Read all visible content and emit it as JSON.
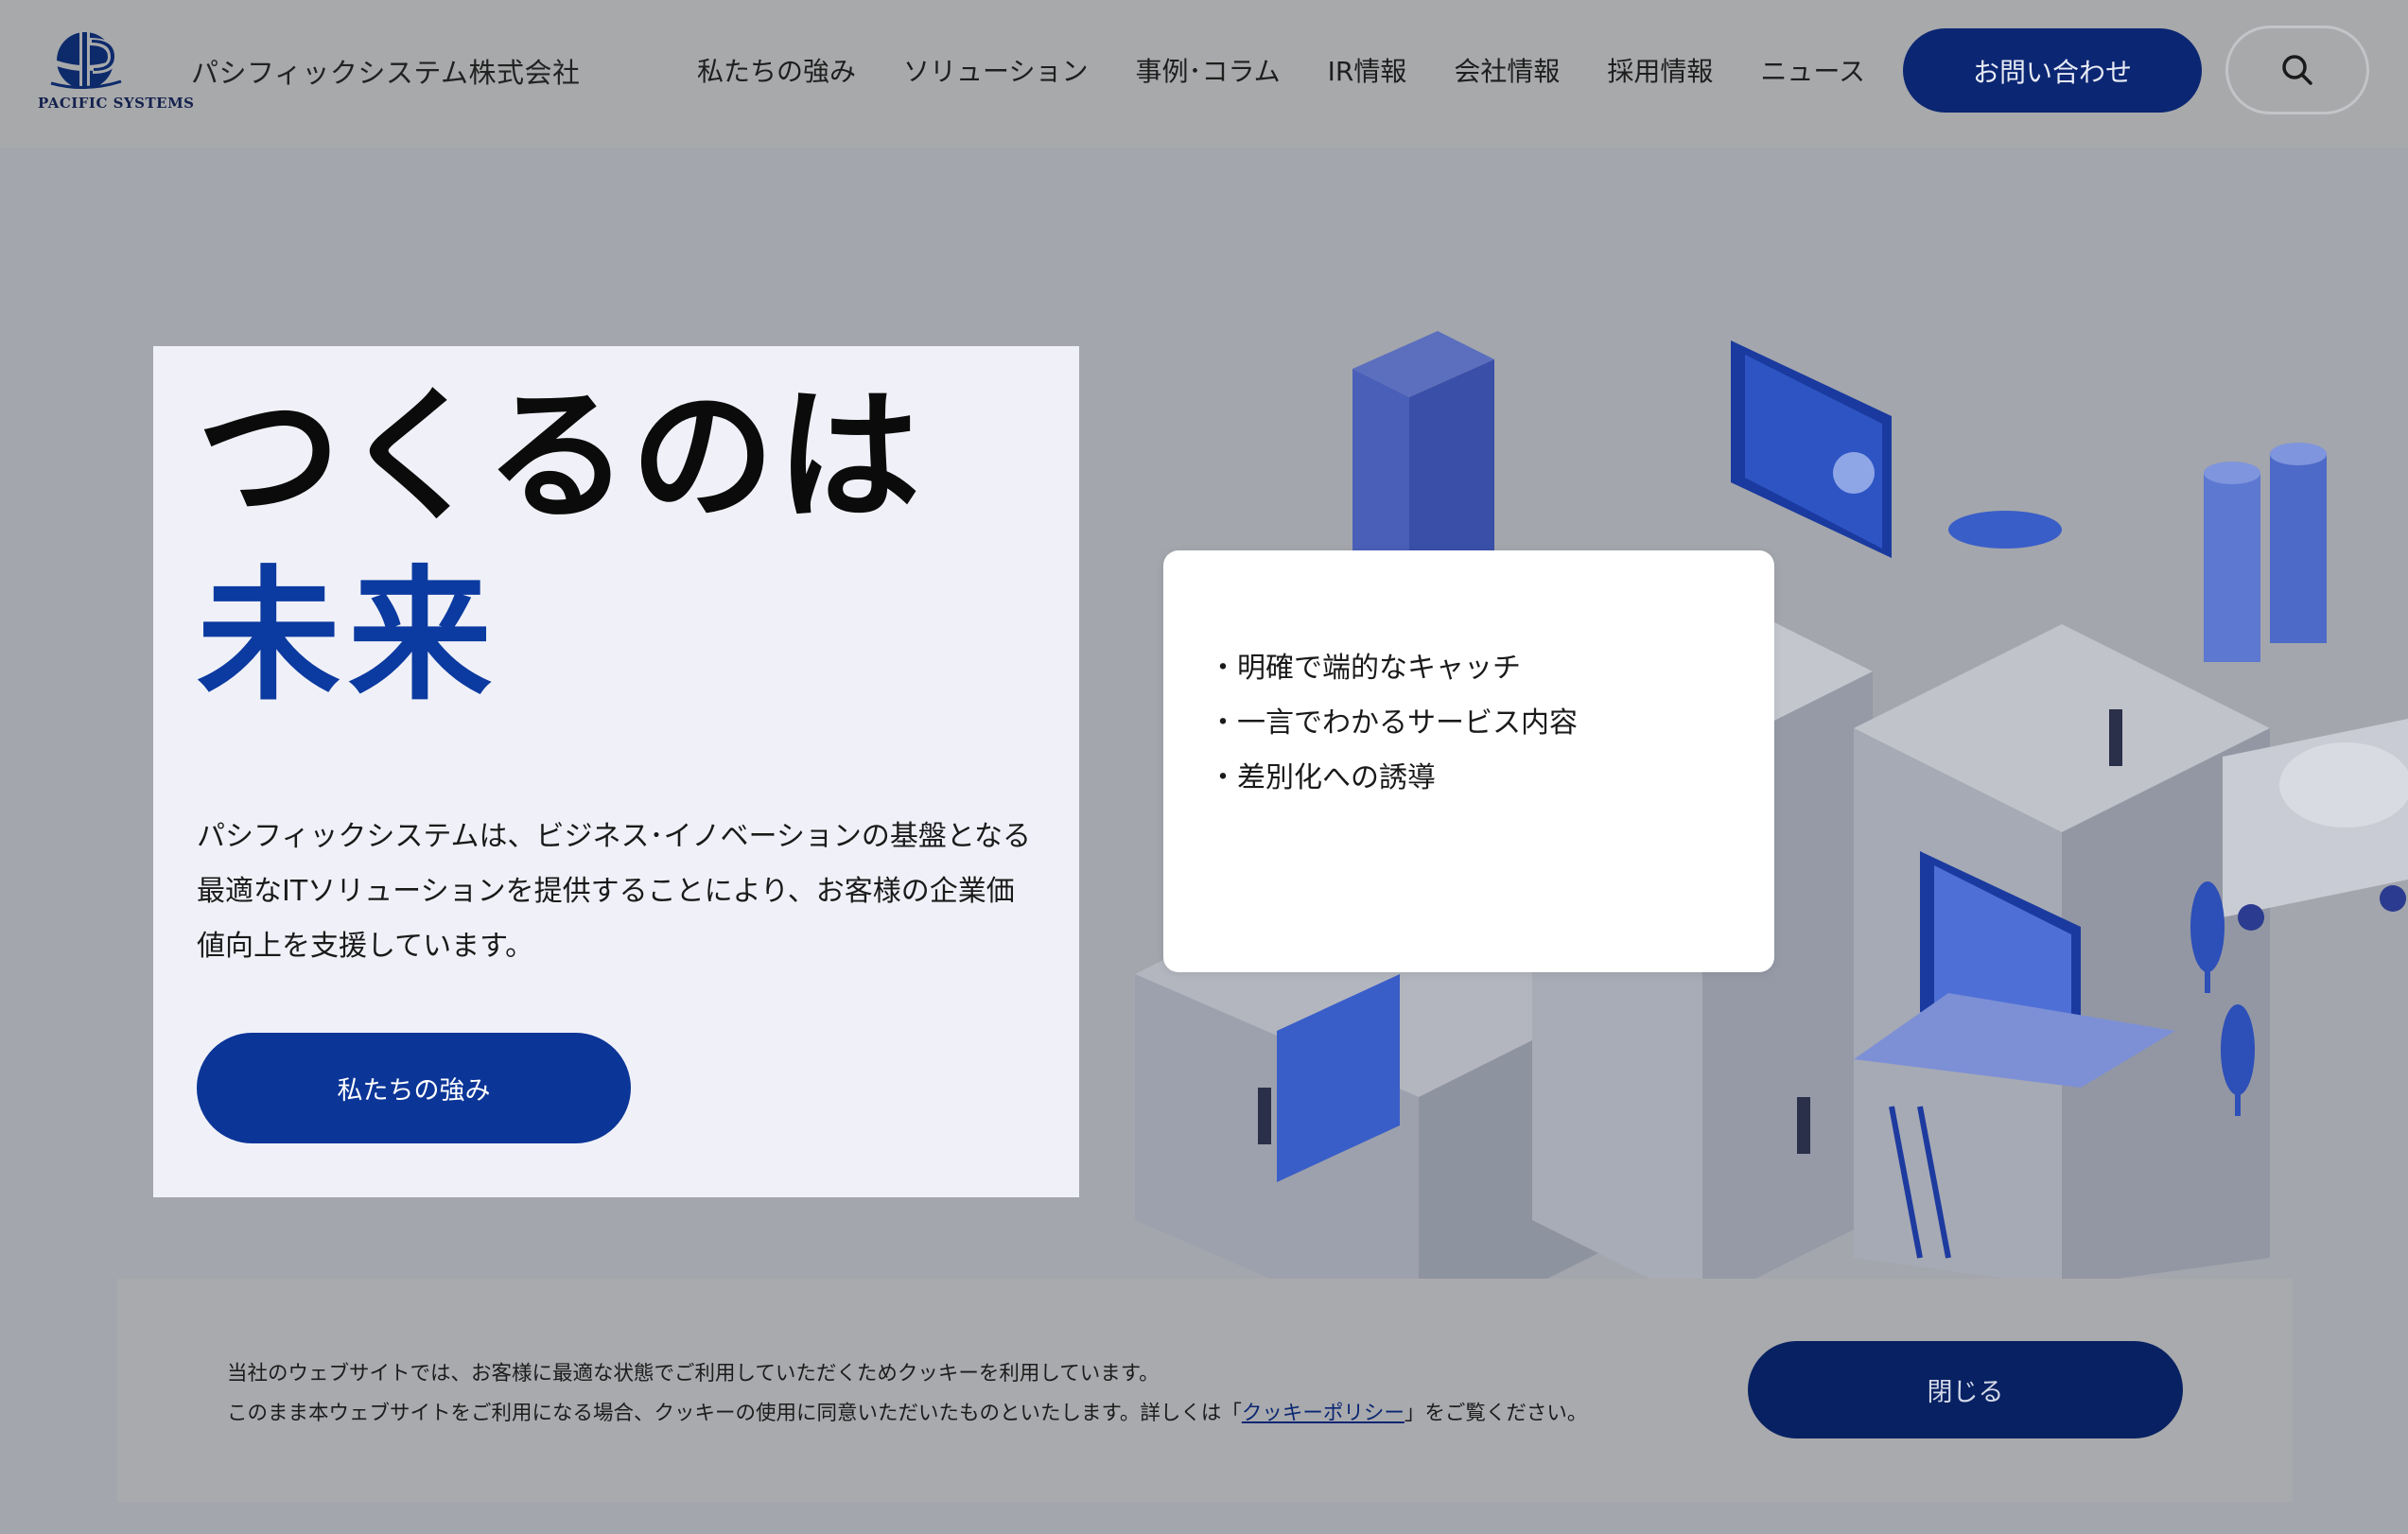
{
  "header": {
    "logo_en": "PACIFIC SYSTEMS",
    "logo_jp": "パシフィックシステム株式会社",
    "nav": [
      "私たちの強み",
      "ソリューション",
      "事例･コラム",
      "IR情報",
      "会社情報",
      "採用情報",
      "ニュース"
    ],
    "contact_label": "お問い合わせ",
    "search_icon": "search-icon"
  },
  "hero": {
    "line1": "つくるのは",
    "line2": "未来",
    "description": "パシフィックシステムは、ビジネス･イノベーションの基盤となる最適なITソリューションを提供することにより、お客様の企業価値向上を支援しています。",
    "button_label": "私たちの強み"
  },
  "popup": {
    "items": [
      "・明確で端的なキャッチ",
      "・一言でわかるサービス内容",
      "・差別化への誘導"
    ]
  },
  "cookie": {
    "line1": "当社のウェブサイトでは、お客様に最適な状態でご利用していただくためクッキーを利用しています。",
    "line2_before": "このまま本ウェブサイトをご利用になる場合、クッキーの使用に同意いただいたものといたします。詳しくは「",
    "link_label": "クッキーポリシー",
    "line2_after": "」をご覧ください。",
    "close_label": "閉じる"
  },
  "colors": {
    "brand_navy": "#0b2672",
    "brand_blue": "#0b3aa0",
    "overlay_gray": "#a3a6ac"
  }
}
